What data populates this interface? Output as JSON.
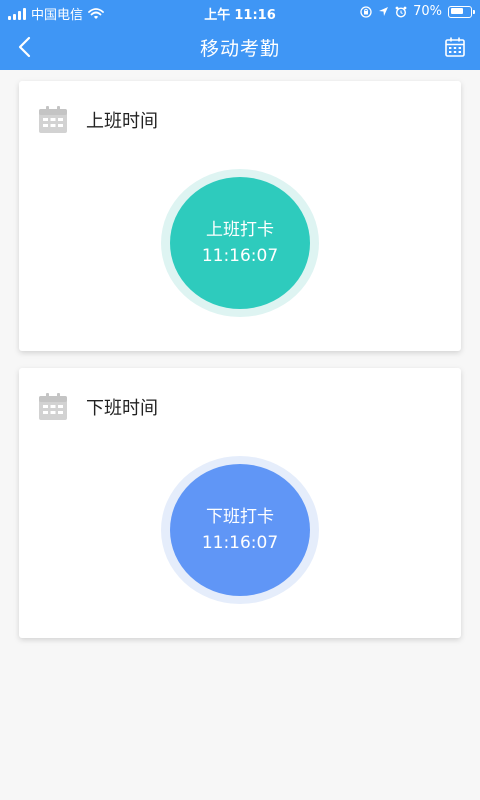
{
  "status_bar": {
    "carrier": "中国电信",
    "time_prefix": "上午",
    "time": "11:16",
    "battery_percent": "70%",
    "battery_level": 0.7
  },
  "nav": {
    "title": "移动考勤",
    "back_icon": "chevron-left-icon",
    "right_icon": "calendar-icon"
  },
  "cards": {
    "clock_in": {
      "title": "上班时间",
      "button_label": "上班打卡",
      "button_time": "11:16:07",
      "button_color": "#2ecbbd",
      "ring_color": "#def4f2"
    },
    "clock_out": {
      "title": "下班时间",
      "button_label": "下班打卡",
      "button_time": "11:16:07",
      "button_color": "#6096f6",
      "ring_color": "#e5edfb"
    }
  },
  "colors": {
    "header_bg": "#3f96f5",
    "page_bg": "#f7f7f7",
    "card_icon": "#d2d2d2"
  }
}
